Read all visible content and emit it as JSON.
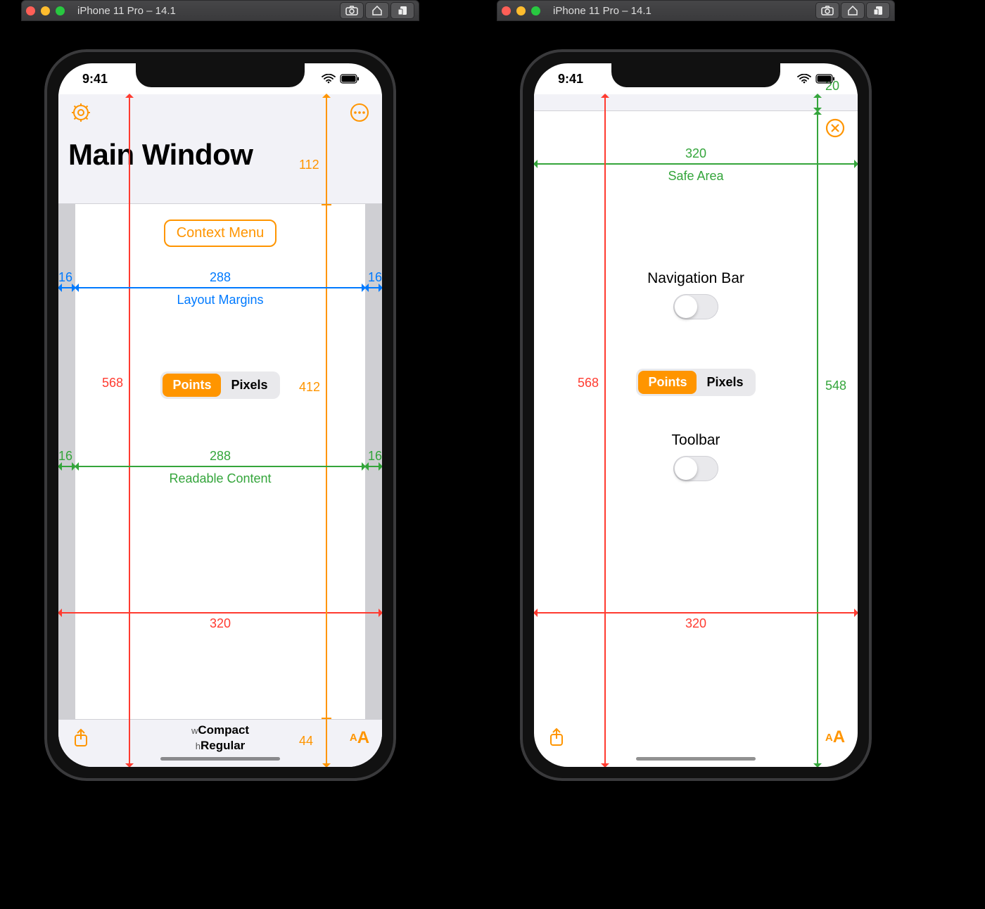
{
  "simulator": {
    "title": "iPhone 11 Pro – 14.1",
    "status_time": "9:41"
  },
  "screen_a": {
    "nav_title": "Main Window",
    "context_menu_label": "Context Menu",
    "segmented": {
      "points": "Points",
      "pixels": "Pixels"
    },
    "footer": {
      "w_label": "w",
      "w_value": "Compact",
      "h_label": "h",
      "h_value": "Regular"
    },
    "measurements": {
      "window_height": "568",
      "window_width": "320",
      "nav_height": "112",
      "content_height": "412",
      "toolbar_height": "44",
      "layout_margin_left": "16",
      "layout_margin_right": "16",
      "layout_margins_width": "288",
      "layout_margins_caption": "Layout Margins",
      "readable_left": "16",
      "readable_right": "16",
      "readable_width": "288",
      "readable_caption": "Readable Content"
    }
  },
  "screen_b": {
    "safe_area_top": "20",
    "safe_area_width": "320",
    "safe_area_caption": "Safe Area",
    "window_height": "568",
    "safe_area_height": "548",
    "window_width": "320",
    "nav_label": "Navigation Bar",
    "toolbar_label": "Toolbar",
    "segmented": {
      "points": "Points",
      "pixels": "Pixels"
    }
  }
}
